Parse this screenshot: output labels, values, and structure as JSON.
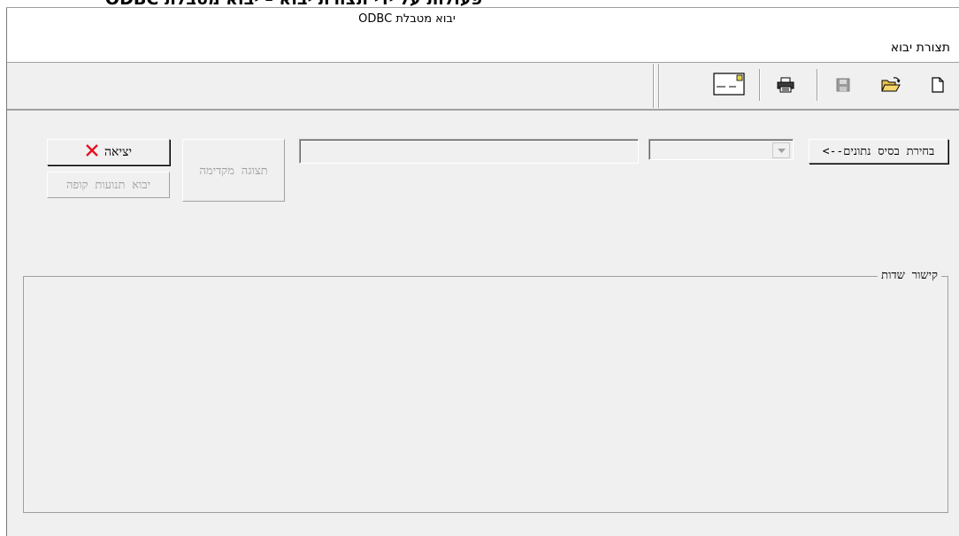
{
  "caption": "פעולות על ידי תצורת יבוא – יבוא מטבלת ODBC",
  "window": {
    "title": "יבוא מטבלת ODBC"
  },
  "menu": {
    "items": [
      "תצורת יבוא"
    ]
  },
  "toolbar": {
    "buttons": [
      "new-document-icon",
      "open-folder-icon",
      "save-disk-icon",
      "print-icon",
      "card-icon"
    ]
  },
  "form": {
    "select_db_button": "בחירת בסיס נתונים-->",
    "table_select_value": "",
    "path_field_value": "",
    "preview_button": "תצוגה מקדימה",
    "exit_button": "יציאה",
    "import_button": "יבוא תנועות קופה",
    "fields_group_label": "קישור שדות"
  },
  "colors": {
    "exit_icon": "#e81123",
    "window_bg": "#f0f0f0"
  }
}
